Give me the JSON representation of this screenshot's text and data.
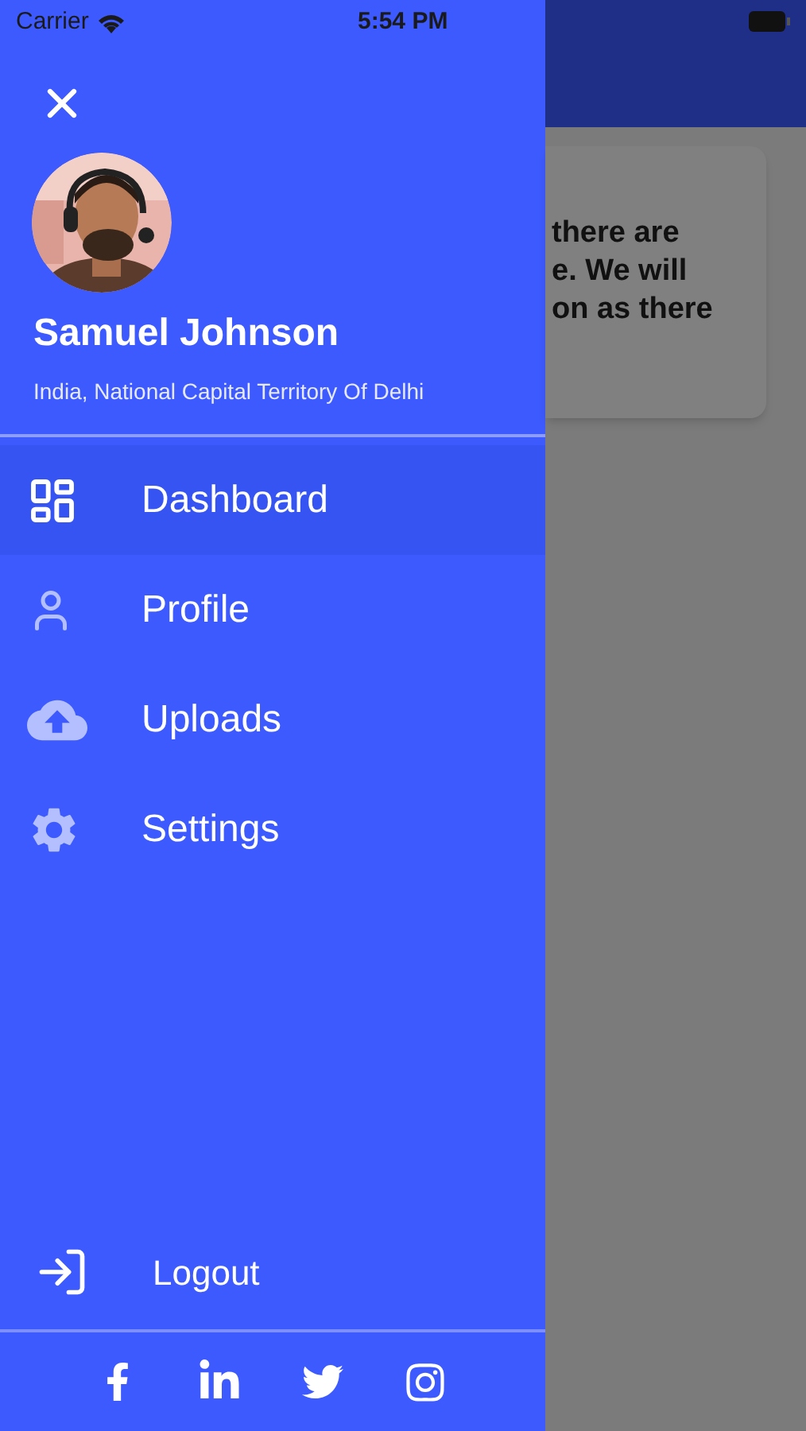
{
  "status_bar": {
    "carrier": "Carrier",
    "time": "5:54 PM"
  },
  "background_card": {
    "lines": [
      "there are",
      "e. We will",
      "on as there"
    ]
  },
  "drawer": {
    "user": {
      "name": "Samuel Johnson",
      "location": "India, National Capital Territory Of Delhi"
    },
    "menu": [
      {
        "label": "Dashboard",
        "selected": true
      },
      {
        "label": "Profile",
        "selected": false
      },
      {
        "label": "Uploads",
        "selected": false
      },
      {
        "label": "Settings",
        "selected": false
      }
    ],
    "logout": "Logout"
  }
}
